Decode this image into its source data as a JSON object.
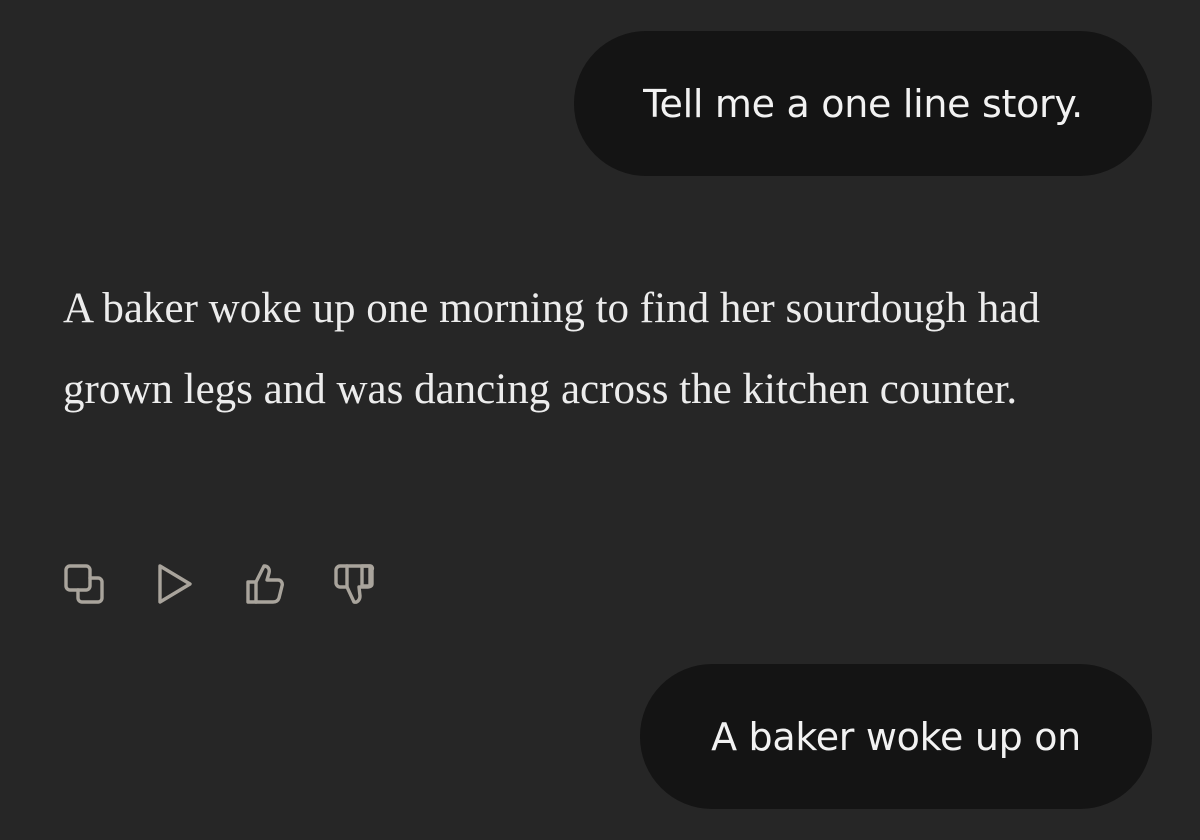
{
  "conversation": {
    "messages": [
      {
        "role": "user",
        "text": "Tell me a one line story."
      },
      {
        "role": "assistant",
        "text": "A baker woke up one morning to find her sourdough had grown legs and was dancing across the kitchen counter."
      },
      {
        "role": "user",
        "text": "A baker woke up on"
      }
    ]
  },
  "actions": [
    {
      "name": "copy",
      "icon": "copy-icon"
    },
    {
      "name": "read-aloud",
      "icon": "play-icon"
    },
    {
      "name": "thumbs-up",
      "icon": "thumbs-up-icon"
    },
    {
      "name": "thumbs-down",
      "icon": "thumbs-down-icon"
    }
  ],
  "colors": {
    "background": "#262626",
    "user_bubble": "#141414",
    "text": "#ececec",
    "icon": "#a9a49c"
  }
}
